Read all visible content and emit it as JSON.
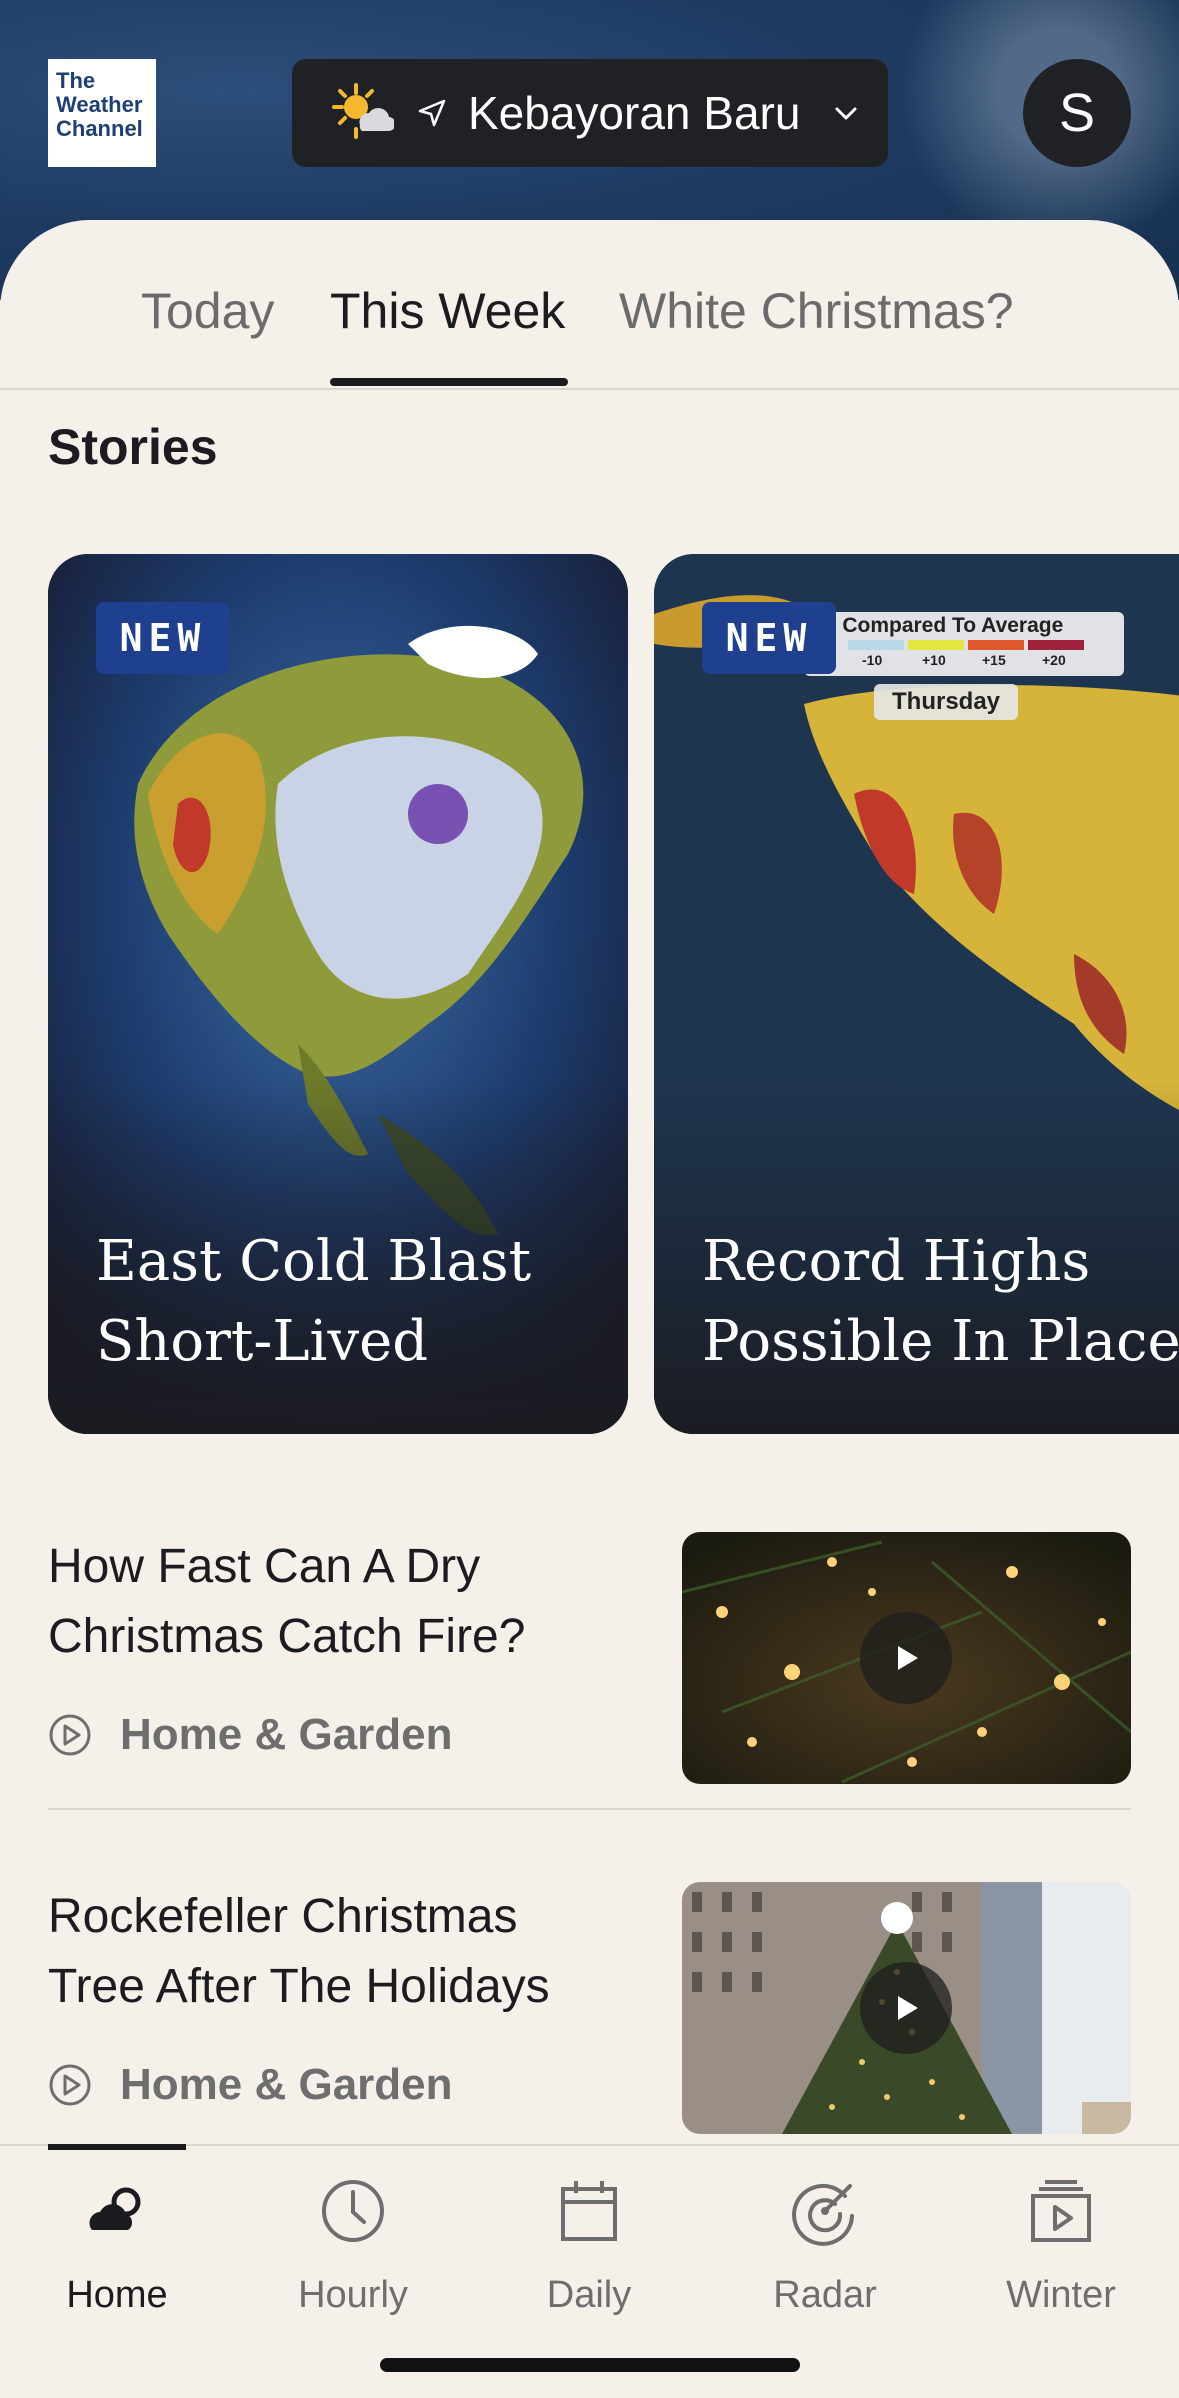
{
  "header": {
    "logo_lines": [
      "The",
      "Weather",
      "Channel"
    ],
    "location": "Kebayoran Baru",
    "avatar_initial": "S"
  },
  "tabs": [
    {
      "label": "Today",
      "active": false
    },
    {
      "label": "This Week",
      "active": true
    },
    {
      "label": "White Christmas?",
      "active": false
    }
  ],
  "stories_heading": "Stories",
  "stories": [
    {
      "badge": "NEW",
      "title": "East Cold Blast Short-Lived"
    },
    {
      "badge": "NEW",
      "title": "Record Highs Possible In Places",
      "map_legend_title": "hs Compared To Average",
      "map_legend_values": [
        "-10",
        "+10",
        "+15",
        "+20"
      ],
      "map_day": "Thursday"
    }
  ],
  "articles": [
    {
      "title": "How Fast Can A Dry Christmas Catch Fire?",
      "category": "Home & Garden"
    },
    {
      "title": "Rockefeller Christmas Tree After The Holidays",
      "category": "Home & Garden"
    }
  ],
  "nav": [
    {
      "label": "Home",
      "icon": "cloud-icon",
      "active": true
    },
    {
      "label": "Hourly",
      "icon": "clock-icon",
      "active": false
    },
    {
      "label": "Daily",
      "icon": "calendar-icon",
      "active": false
    },
    {
      "label": "Radar",
      "icon": "radar-icon",
      "active": false
    },
    {
      "label": "Winter",
      "icon": "video-icon",
      "active": false
    }
  ],
  "colors": {
    "header_bg": "#1f3b62",
    "sheet_bg": "#f5f0ea",
    "badge_bg": "#1f3f8f",
    "pill_bg": "#1f2125"
  }
}
